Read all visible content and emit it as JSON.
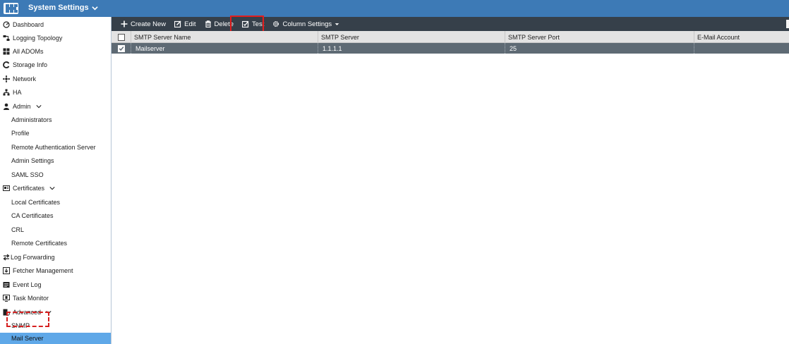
{
  "topbar": {
    "title": "System Settings",
    "bg_color": "#3d7ab6"
  },
  "sidebar": {
    "items": [
      {
        "label": "Dashboard",
        "icon": "dashboard-icon",
        "level": "top"
      },
      {
        "label": "Logging Topology",
        "icon": "topology-icon",
        "level": "top"
      },
      {
        "label": "All ADOMs",
        "icon": "adoms-icon",
        "level": "top"
      },
      {
        "label": "Storage Info",
        "icon": "storage-icon",
        "level": "top"
      },
      {
        "label": "Network",
        "icon": "network-icon",
        "level": "top"
      },
      {
        "label": "HA",
        "icon": "ha-icon",
        "level": "top"
      },
      {
        "label": "Admin",
        "icon": "user-icon",
        "level": "top",
        "expandable": true
      },
      {
        "label": "Administrators",
        "level": "sub"
      },
      {
        "label": "Profile",
        "level": "sub"
      },
      {
        "label": "Remote Authentication Server",
        "level": "sub"
      },
      {
        "label": "Admin Settings",
        "level": "sub"
      },
      {
        "label": "SAML SSO",
        "level": "sub"
      },
      {
        "label": "Certificates",
        "icon": "certificate-icon",
        "level": "top",
        "expandable": true
      },
      {
        "label": "Local Certificates",
        "level": "sub"
      },
      {
        "label": "CA Certificates",
        "level": "sub"
      },
      {
        "label": "CRL",
        "level": "sub"
      },
      {
        "label": "Remote Certificates",
        "level": "sub"
      },
      {
        "label": "Log Forwarding",
        "icon": "forward-icon",
        "level": "top"
      },
      {
        "label": "Fetcher Management",
        "icon": "fetcher-icon",
        "level": "top"
      },
      {
        "label": "Event Log",
        "icon": "event-log-icon",
        "level": "top"
      },
      {
        "label": "Task Monitor",
        "icon": "task-monitor-icon",
        "level": "top"
      },
      {
        "label": "Advanced",
        "icon": "advanced-icon",
        "level": "top",
        "expandable": true
      },
      {
        "label": "SNMP",
        "level": "sub"
      },
      {
        "label": "Mail Server",
        "level": "sub",
        "active": true
      }
    ]
  },
  "toolbar": {
    "create_label": "Create New",
    "edit_label": "Edit",
    "delete_label": "Delete",
    "test_label": "Test",
    "column_settings_label": "Column Settings"
  },
  "table": {
    "columns": [
      "SMTP Server Name",
      "SMTP Server",
      "SMTP Server Port",
      "E-Mail Account"
    ],
    "rows": [
      {
        "selected": true,
        "cells": [
          "Mailserver",
          "1.1.1.1",
          "25",
          ""
        ]
      }
    ]
  },
  "colors": {
    "toolbar_bg": "#36404a",
    "active_nav": "#5fa8e8",
    "selected_row": "#5e6a74",
    "highlight": "#e21e1e"
  }
}
